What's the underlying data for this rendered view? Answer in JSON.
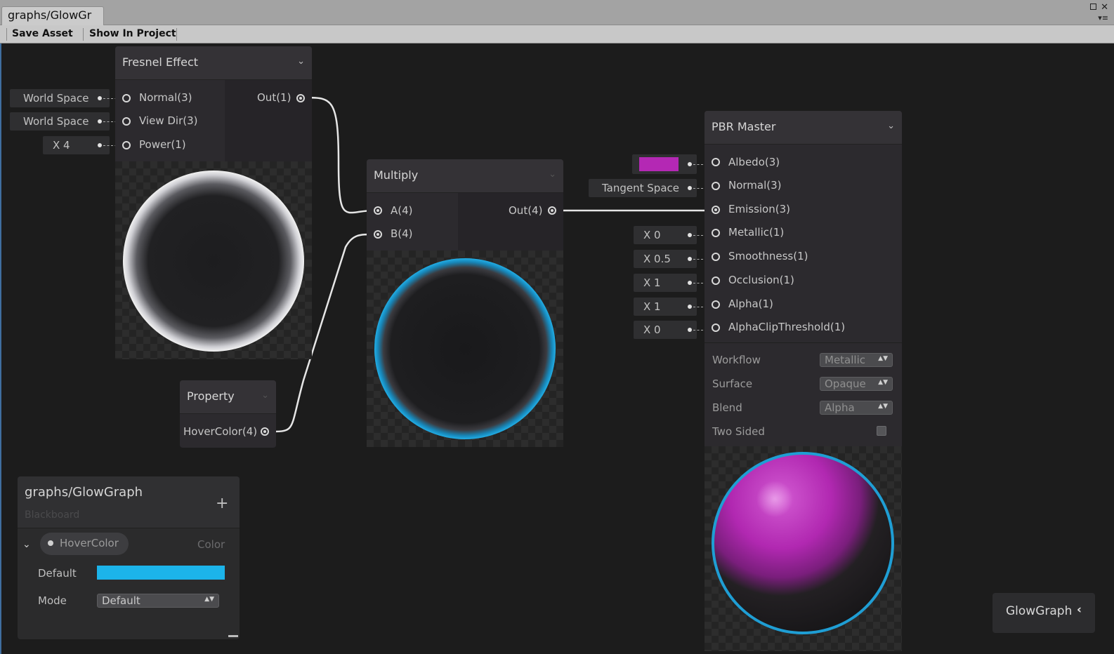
{
  "window": {
    "tab_title": "graphs/GlowGr",
    "maximize_icon": "maximize-icon",
    "close_icon": "close-icon",
    "menu_icon": "window-menu-icon"
  },
  "toolbar": {
    "save_label": "Save Asset",
    "show_label": "Show In Project"
  },
  "fresnel": {
    "title": "Fresnel Effect",
    "inputs": [
      "Normal(3)",
      "View Dir(3)",
      "Power(1)"
    ],
    "output": "Out(1)",
    "chips": [
      "World Space",
      "World Space",
      "X 4"
    ]
  },
  "multiply": {
    "title": "Multiply",
    "inputs": [
      "A(4)",
      "B(4)"
    ],
    "output": "Out(4)"
  },
  "property": {
    "title": "Property",
    "output": "HoverColor(4)"
  },
  "pbr": {
    "title": "PBR Master",
    "inputs": [
      "Albedo(3)",
      "Normal(3)",
      "Emission(3)",
      "Metallic(1)",
      "Smoothness(1)",
      "Occlusion(1)",
      "Alpha(1)",
      "AlphaClipThreshold(1)"
    ],
    "chips": {
      "albedo_color": "#b428b4",
      "normal": "Tangent Space",
      "metallic": "X 0",
      "smoothness": "X 0.5",
      "occlusion": "X 1",
      "alpha": "X 1",
      "clip": "X 0"
    },
    "settings": [
      {
        "label": "Workflow",
        "value": "Metallic"
      },
      {
        "label": "Surface",
        "value": "Opaque"
      },
      {
        "label": "Blend",
        "value": "Alpha"
      },
      {
        "label": "Two Sided",
        "value": ""
      }
    ]
  },
  "blackboard": {
    "title": "graphs/GlowGraph",
    "subtitle": "Blackboard",
    "add_icon": "plus-icon",
    "property_name": "HoverColor",
    "property_type": "Color",
    "default_label": "Default",
    "default_color": "#1cb4ea",
    "mode_label": "Mode",
    "mode_value": "Default"
  },
  "graph_tag": {
    "label": "GlowGraph",
    "icon": "chevron-left-icon"
  },
  "colors": {
    "accent_blue": "#1cb4ea",
    "emission_magenta": "#b428b4",
    "canvas": "#1c1c1c"
  }
}
